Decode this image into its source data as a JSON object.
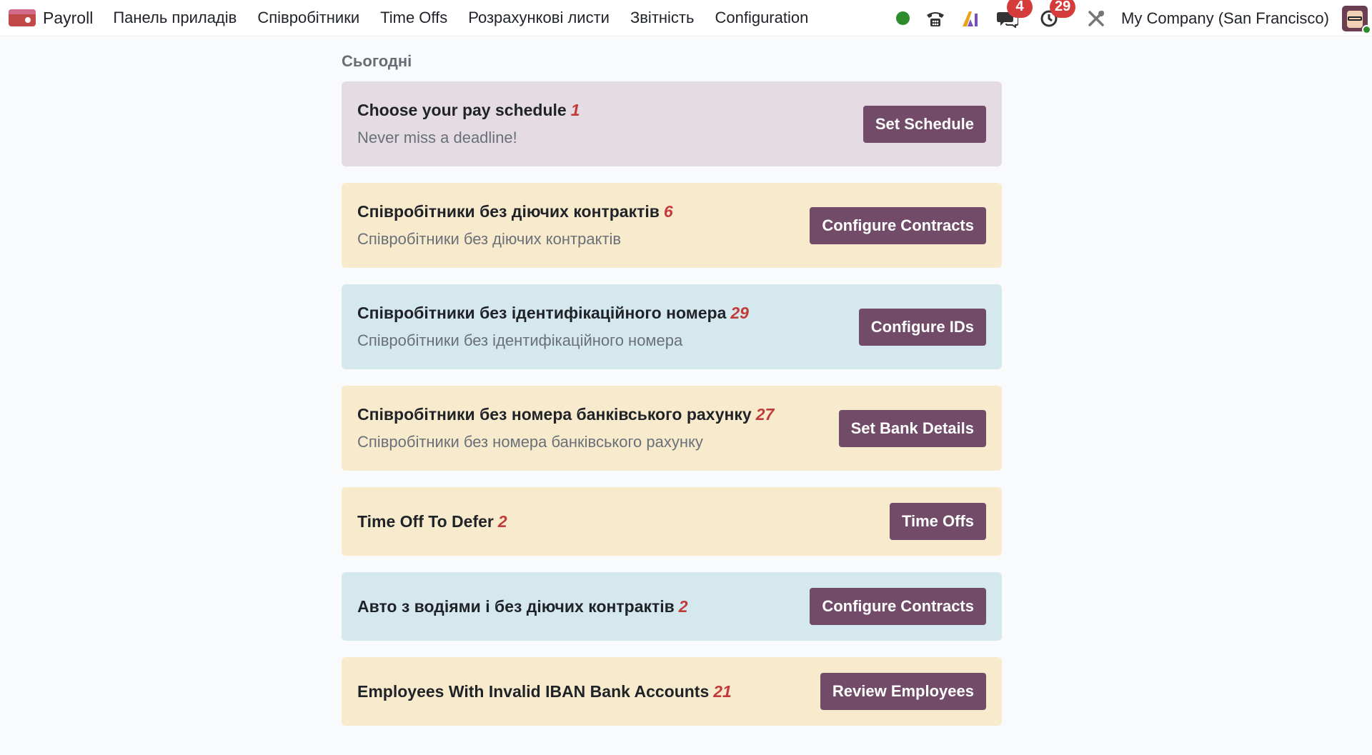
{
  "navbar": {
    "brand": "Payroll",
    "menu": [
      "Панель приладів",
      "Співробітники",
      "Time Offs",
      "Розрахункові листи",
      "Звітність",
      "Configuration"
    ],
    "messages_count": "4",
    "activities_count": "29",
    "company": "My Company (San Francisco)"
  },
  "section": {
    "title": "Сьогодні"
  },
  "cards": [
    {
      "title": "Choose your pay schedule",
      "count": "1",
      "subtitle": "Never miss a deadline!",
      "button": "Set Schedule",
      "bg": "#e5dce3"
    },
    {
      "title": "Співробітники без діючих контрактів",
      "count": "6",
      "subtitle": "Співробітники без діючих контрактів",
      "button": "Configure Contracts",
      "bg": "#f8ebcd"
    },
    {
      "title": "Співробітники без ідентифікаційного номера",
      "count": "29",
      "subtitle": "Співробітники без ідентифікаційного номера",
      "button": "Configure IDs",
      "bg": "#d5e8ee"
    },
    {
      "title": "Співробітники без номера банківського рахунку",
      "count": "27",
      "subtitle": "Співробітники без номера банківського рахунку",
      "button": "Set Bank Details",
      "bg": "#f8ebcd"
    },
    {
      "title": "Time Off To Defer",
      "count": "2",
      "button": "Time Offs",
      "bg": "#f8ebcd"
    },
    {
      "title": "Авто з водіями і без діючих контрактів",
      "count": "2",
      "button": "Configure Contracts",
      "bg": "#d5e8ee"
    },
    {
      "title": "Employees With Invalid IBAN Bank Accounts",
      "count": "21",
      "button": "Review Employees",
      "bg": "#f8ebcd"
    }
  ],
  "colors": {
    "primary_button": "#714b67",
    "count_text": "#c23a3a",
    "badge": "#d63b3b",
    "online": "#2e8b2e"
  },
  "icons": {
    "app": "payroll-app-icon",
    "status": "status-dot-icon",
    "phone": "phone-icon",
    "ai": "ai-icon",
    "messages": "chat-icon",
    "activities": "clock-icon",
    "debug": "tools-icon"
  }
}
